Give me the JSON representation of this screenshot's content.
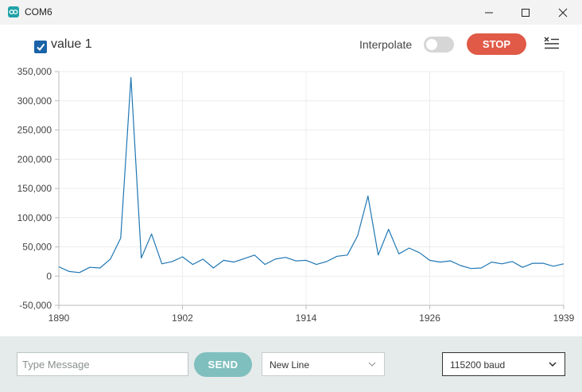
{
  "window": {
    "title": "COM6"
  },
  "toolbar": {
    "series_label": "value 1",
    "series_checked": true,
    "interpolate_label": "Interpolate",
    "interpolate_on": false,
    "stop_label": "STOP"
  },
  "footer": {
    "message_placeholder": "Type Message",
    "send_label": "SEND",
    "line_ending": "New Line",
    "baud_rate": "115200 baud"
  },
  "colors": {
    "series": "#1f77b4",
    "stop": "#e05a47",
    "send": "#7fbfbe",
    "checkbox": "#1a63a8"
  },
  "chart_data": {
    "type": "line",
    "title": "",
    "xlabel": "",
    "ylabel": "",
    "ylim": [
      -50000,
      350000
    ],
    "xlim": [
      1890,
      1939
    ],
    "x_ticks": [
      "1890",
      "1902",
      "1914",
      "1926",
      "1939"
    ],
    "y_ticks": [
      "350,000",
      "300,000",
      "250,000",
      "200,000",
      "150,000",
      "100,000",
      "50,000",
      "0",
      "-50,000"
    ],
    "grid": true,
    "series": [
      {
        "name": "value 1",
        "x": [
          1890,
          1891,
          1892,
          1893,
          1894,
          1895,
          1896,
          1897,
          1898,
          1899,
          1900,
          1901,
          1902,
          1903,
          1904,
          1905,
          1906,
          1907,
          1908,
          1909,
          1910,
          1911,
          1912,
          1913,
          1914,
          1915,
          1916,
          1917,
          1918,
          1919,
          1920,
          1921,
          1922,
          1923,
          1924,
          1925,
          1926,
          1927,
          1928,
          1929,
          1930,
          1931,
          1932,
          1933,
          1934,
          1935,
          1936,
          1937,
          1938,
          1939
        ],
        "y": [
          16000,
          8000,
          6000,
          15000,
          14000,
          29000,
          65000,
          340000,
          31000,
          72000,
          21000,
          25000,
          33000,
          20000,
          29000,
          14000,
          27000,
          24000,
          30000,
          36000,
          20000,
          29000,
          32000,
          26000,
          27000,
          20000,
          25000,
          34000,
          36000,
          69000,
          137000,
          36000,
          80000,
          38000,
          48000,
          40000,
          27000,
          24000,
          26000,
          18000,
          13000,
          14000,
          24000,
          21000,
          25000,
          15000,
          22000,
          22000,
          17000,
          21000
        ]
      }
    ]
  }
}
